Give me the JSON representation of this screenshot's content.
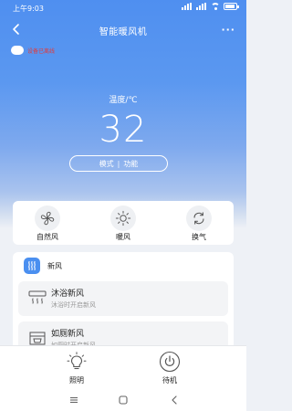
{
  "status_bar": {
    "time": "上午9:03",
    "icons": [
      "signal-icon",
      "signal-icon",
      "wifi-icon",
      "battery-icon"
    ]
  },
  "header": {
    "title": "智能暖风机",
    "back_icon": "back-arrow-icon",
    "more_label": "···"
  },
  "device": {
    "status_text": "设备已离线",
    "status_color": "#e23b3b"
  },
  "temperature": {
    "label": "温度/℃",
    "value": "32"
  },
  "mode_pill": {
    "mode_label": "模式",
    "separator": "|",
    "function_label": "功能"
  },
  "modes": [
    {
      "label": "自然风",
      "icon": "fan-icon"
    },
    {
      "label": "暖风",
      "icon": "sun-icon"
    },
    {
      "label": "换气",
      "icon": "refresh-icon"
    }
  ],
  "fresh_air": {
    "title": "新风",
    "icon": "heat-waves-icon",
    "items": [
      {
        "title": "沐浴新风",
        "subtitle": "沐浴时开启新风",
        "icon": "shower-heat-icon"
      },
      {
        "title": "如厕新风",
        "subtitle": "如厕时开启新风",
        "icon": "toilet-fan-icon"
      }
    ]
  },
  "bottom_controls": [
    {
      "label": "照明",
      "icon": "bulb-icon"
    },
    {
      "label": "待机",
      "icon": "power-icon"
    }
  ],
  "nav": {
    "icons": [
      "menu-icon",
      "home-icon",
      "back-icon"
    ]
  },
  "colors": {
    "accent": "#4a8ff0",
    "header_gradient_top": "#4f8ff0",
    "offline": "#e23b3b"
  }
}
